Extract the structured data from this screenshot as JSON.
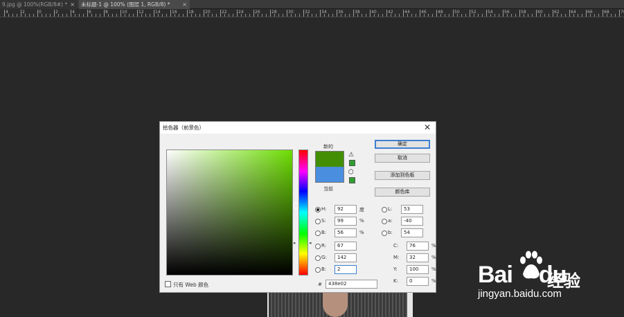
{
  "tabs": [
    {
      "label": "9.jpg @ 100%(RGB/8#) *",
      "close": "×"
    },
    {
      "label": "未标题-1 @ 100% (图层 1, RGB/8) *",
      "close": "×"
    }
  ],
  "ruler": {
    "labels": [
      "4",
      "2",
      "0",
      "2",
      "4",
      "6",
      "8",
      "10",
      "12",
      "14",
      "16",
      "18",
      "20",
      "22",
      "24",
      "26",
      "28",
      "30",
      "32",
      "34",
      "36",
      "38",
      "40",
      "42",
      "44",
      "46",
      "48",
      "50",
      "52",
      "54",
      "56",
      "58",
      "60",
      "62",
      "64",
      "66",
      "68",
      "70"
    ]
  },
  "dialog": {
    "title": "拾色器（前景色）",
    "close": "✕",
    "new_label": "新的",
    "current_label": "当前",
    "new_color": "#438e02",
    "current_color": "#4a8ee0",
    "buttons": {
      "ok": "确定",
      "cancel": "取消",
      "add_swatch": "添加到色板",
      "libraries": "颜色库"
    },
    "fields": {
      "H": {
        "label": "H:",
        "value": "92",
        "unit": "度"
      },
      "S": {
        "label": "S:",
        "value": "99",
        "unit": "%"
      },
      "B": {
        "label": "B:",
        "value": "56",
        "unit": "%"
      },
      "R": {
        "label": "R:",
        "value": "67"
      },
      "G": {
        "label": "G:",
        "value": "142"
      },
      "Bl": {
        "label": "B:",
        "value": "2"
      },
      "L": {
        "label": "L:",
        "value": "53"
      },
      "a": {
        "label": "a:",
        "value": "-40"
      },
      "b": {
        "label": "b:",
        "value": "54"
      },
      "C": {
        "label": "C:",
        "value": "76",
        "unit": "%"
      },
      "M": {
        "label": "M:",
        "value": "32",
        "unit": "%"
      },
      "Y": {
        "label": "Y:",
        "value": "100",
        "unit": "%"
      },
      "K": {
        "label": "K:",
        "value": "0",
        "unit": "%"
      }
    },
    "hex_label": "#",
    "hex_value": "438e02",
    "web_only_label": "只有 Web 颜色"
  },
  "watermark": {
    "logo": "Bai",
    "logo2": "du",
    "cn": "经验",
    "url": "jingyan.baidu.com"
  }
}
